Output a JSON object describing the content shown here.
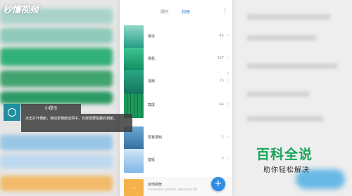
{
  "watermark": "秒懂视频",
  "tabs": {
    "left": "照片",
    "right": "相册"
  },
  "albums": [
    {
      "name": "最近",
      "count": "45",
      "color": "#2e9e88"
    },
    {
      "name": "相机",
      "count": "307",
      "color": "#1aa07e"
    },
    {
      "name": "视频",
      "count": "15",
      "color": "#1c8d7a"
    },
    {
      "name": "截屏",
      "count": "44",
      "color": "#148a52"
    },
    {
      "name": "屏幕录制",
      "count": "1",
      "color": "#3b7fb3"
    },
    {
      "name": "壁纸",
      "count": "7",
      "color": "#7fb7e6"
    }
  ],
  "other": {
    "name": "其他相册",
    "subtitle": "Screenshot, portrait, wbesackers等"
  },
  "tip": {
    "title": "小提示",
    "body": "点击打开相册，滑动至相册选项中，长按需要隐藏的相册。"
  },
  "brand": {
    "title": "百科全说",
    "subtitle": "助你轻松解决"
  },
  "colors": {
    "accent": "#2d8de6",
    "tip_bg": "#1f8fa0",
    "brand": "#18a55a"
  }
}
